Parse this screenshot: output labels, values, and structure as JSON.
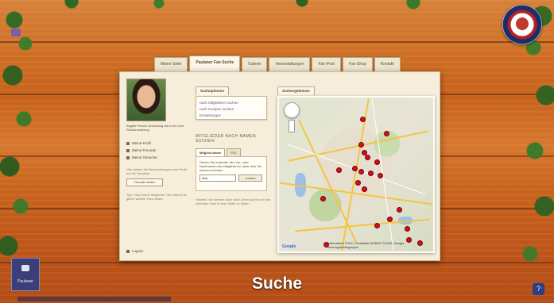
{
  "caption": "Suche",
  "tabs": [
    {
      "label": "Meine Seite",
      "active": false
    },
    {
      "label": "Paulaner Fan Suche",
      "active": true
    },
    {
      "label": "Galerie",
      "active": false
    },
    {
      "label": "Veranstaltungen",
      "active": false
    },
    {
      "label": "Fan-Post",
      "active": false
    },
    {
      "label": "Fan-Shop",
      "active": false
    },
    {
      "label": "Kontakt",
      "active": false
    }
  ],
  "profile": {
    "caption": "Brigitte Peschl, Anstellung als ihr für Ulm. Rückumsetzung",
    "links": [
      "Meine Profil",
      "Meine Freunde",
      "Meine Gesuche"
    ],
    "hint": "Hier stehen die Beschreibungen zum Profil auf die Hinweise",
    "button_label": "Freunde finden",
    "hint2": "Tipp: Noch keine Mitglieder. Hier kannst du gleich weitere Fans finden",
    "logout": "Logout"
  },
  "middle": {
    "subtab": "Suchoptionen",
    "links": [
      "nach Mitgliedern suchen",
      "nach Kneipen suchen",
      "Einstellungen"
    ],
    "section_title": "MITGLIEDER NACH NAMEN SUCHEN",
    "mini_tabs": [
      "Mitglied-Name",
      "PLZ"
    ],
    "search_text": "Geben Sie entweder den Vor- oder Nachnamen des Mitglieds ein nach dem Sie suchen möchten.",
    "input_value": "Max",
    "search_button": "suchen",
    "note": "Hinweis: Sie können auch nach Orten suchen um die nächsten Fans in ihrer Nähe zu finden."
  },
  "map": {
    "tab": "Suchergebnisse",
    "brand": "Google",
    "copyright": "Kartendaten ©2011 GeoBasis-DE/BKG ©2009, Google - Nutzungsbedingungen"
  },
  "logo_text": "PAULANER",
  "bottom_tile_label": "Paulaner",
  "help_badge": "?",
  "colors": {
    "wood": "#c7621a",
    "panel": "#f6eedb",
    "marker": "#d10f1f",
    "caption": "#ffffff"
  }
}
